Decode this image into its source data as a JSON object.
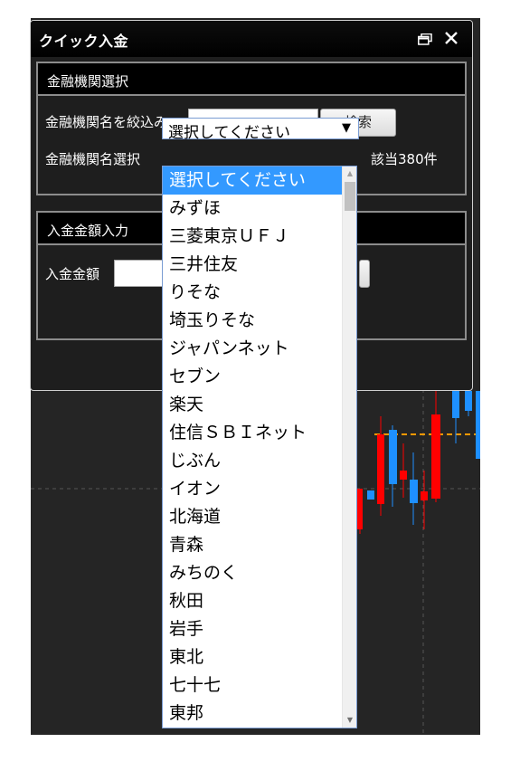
{
  "dialog": {
    "title": "クイック入金",
    "restore_icon": "restore-icon",
    "close_icon": "close-icon"
  },
  "bank_section": {
    "header": "金融機関選択",
    "filter_label": "金融機関名を絞込み",
    "filter_value": "",
    "search_button": "検索",
    "select_label": "金融機関名選択",
    "select_value": "選択してください",
    "count_text": "該当380件"
  },
  "amount_section": {
    "header": "入金金額入力",
    "amount_label": "入金金額",
    "amount_value": ""
  },
  "dropdown": {
    "selected_index": 0,
    "options": [
      "選択してください",
      "みずほ",
      "三菱東京ＵＦＪ",
      "三井住友",
      "りそな",
      "埼玉りそな",
      "ジャパンネット",
      "セブン",
      "楽天",
      "住信ＳＢＩネット",
      "じぶん",
      "イオン",
      "北海道",
      "青森",
      "みちのく",
      "秋田",
      "岩手",
      "東北",
      "七十七",
      "東邦"
    ]
  },
  "colors": {
    "selected_option": "#3399ff",
    "candle_up": "#ff0000",
    "candle_down": "#1e90ff",
    "price_line": "#ff9900"
  }
}
